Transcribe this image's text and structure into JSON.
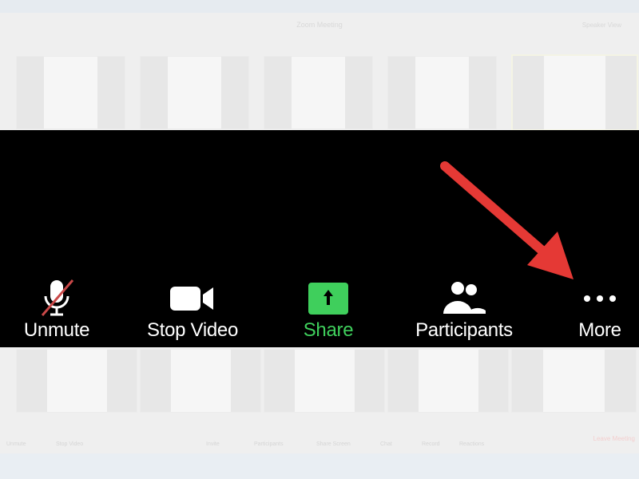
{
  "window": {
    "title": "Zoom Meeting",
    "view_label": "Speaker View"
  },
  "toolbar": {
    "buttons": [
      {
        "label": "Unmute",
        "icon": "mic-muted-icon"
      },
      {
        "label": "Stop Video",
        "icon": "video-camera-icon"
      },
      {
        "label": "Share",
        "icon": "share-up-arrow-icon"
      },
      {
        "label": "Participants",
        "icon": "participants-icon"
      },
      {
        "label": "More",
        "icon": "more-dots-icon"
      }
    ]
  },
  "background_toolbar": {
    "items": [
      "Unmute",
      "Stop Video",
      "Invite",
      "Participants",
      "Share Screen",
      "Chat",
      "Record",
      "Reactions"
    ],
    "leave": "Leave Meeting"
  },
  "colors": {
    "share_green": "#3fcf5c",
    "arrow_red": "#e53935",
    "mute_slash": "#d9534f"
  }
}
